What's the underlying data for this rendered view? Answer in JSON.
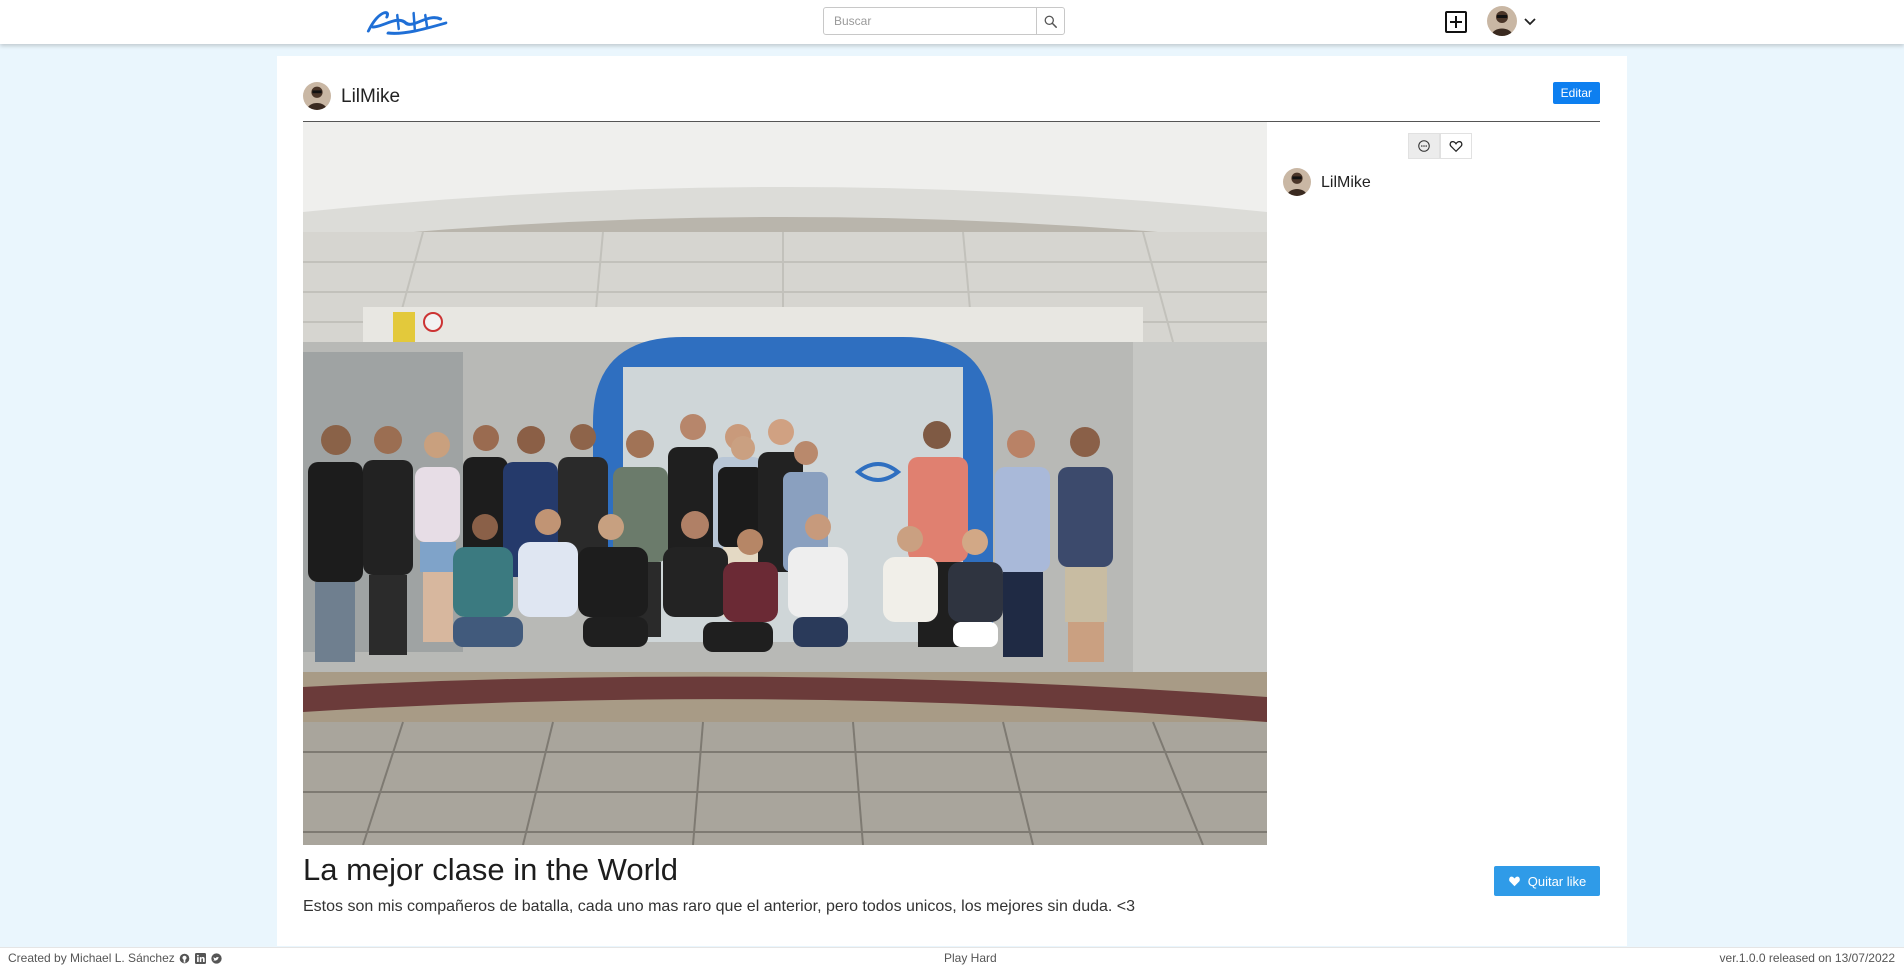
{
  "navbar": {
    "logo_text": "Castellk",
    "search": {
      "placeholder": "Buscar",
      "value": ""
    },
    "icons": {
      "search": "search-icon",
      "new_post": "plus-square-icon",
      "menu": "chevron-down-icon"
    }
  },
  "post": {
    "author": "LilMike",
    "edit_label": "Editar",
    "image_alt": "Foto de grupo de la clase",
    "title": "La mejor clase in the World",
    "description": "Estos son mis compañeros de batalla, cada uno mas raro que el anterior, pero todos unicos, los mejores sin duda. <3",
    "unlike_label": "Quitar like",
    "icons": {
      "comment": "comment-icon",
      "like": "heart-outline-icon",
      "unlike": "heart-filled-icon"
    }
  },
  "comments": [
    {
      "user": "LilMike"
    }
  ],
  "footer": {
    "credit": "Created by Michael L. Sánchez",
    "motto": "Play Hard",
    "version": "ver.1.0.0 released on 13/07/2022",
    "icons": [
      "github-icon",
      "linkedin-icon",
      "twitter-icon"
    ]
  },
  "colors": {
    "page_bg": "#eaf6fd",
    "brand": "#1f6fd6",
    "edit_button": "#0d7ff0",
    "like_button": "#2f9be8"
  }
}
